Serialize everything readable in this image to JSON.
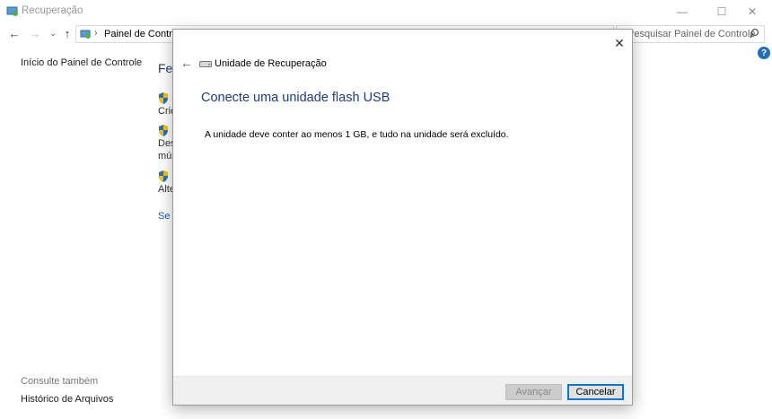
{
  "window": {
    "title": "Recuperação",
    "minimize_glyph": "—",
    "maximize_glyph": "☐",
    "close_glyph": "✕"
  },
  "nav": {
    "back_glyph": "←",
    "forward_glyph": "→",
    "recent_glyph": "⌄",
    "up_glyph": "↑",
    "breadcrumb_sep": "›",
    "address": "Painel de Controle",
    "search_placeholder": "Pesquisar Painel de Controle"
  },
  "help_glyph": "?",
  "sidebar": {
    "home": "Início do Painel de Controle",
    "see_also": "Consulte também",
    "history": "Histórico de Arquivos"
  },
  "background": {
    "heading": "Fer",
    "item1": "Crie",
    "item2_line1": "Des",
    "item2_line2": "mús",
    "item3": "Alte",
    "link": "Se e"
  },
  "dialog": {
    "close_glyph": "✕",
    "back_glyph": "←",
    "title": "Unidade de Recuperação",
    "heading": "Conecte uma unidade flash USB",
    "body": "A unidade deve conter ao menos 1 GB, e tudo na unidade será excluído.",
    "next_label": "Avançar",
    "cancel_label": "Cancelar"
  },
  "colors": {
    "heading_blue": "#1e3d7a",
    "link_blue": "#1a5fb4",
    "accent": "#0078d7"
  }
}
